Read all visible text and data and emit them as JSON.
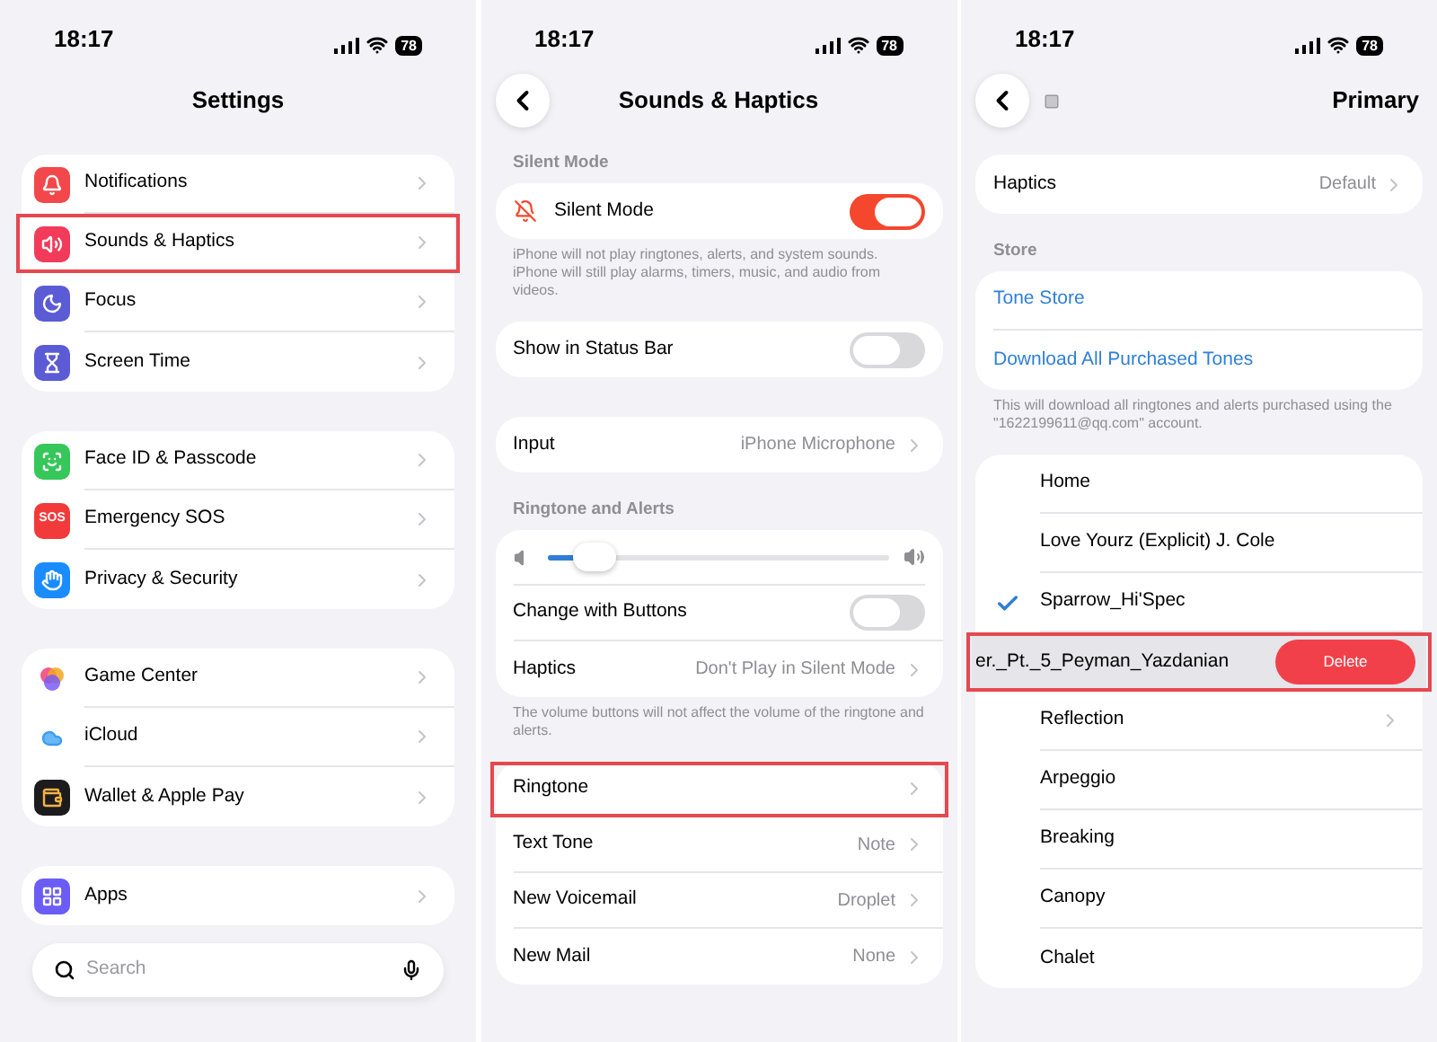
{
  "screens": [
    {
      "kind": "root",
      "status_bar": {
        "time": "18:17",
        "battery": "78"
      },
      "title": "Settings",
      "sections": [
        {
          "rows": [
            {
              "kind": "app",
              "label": "Notifications",
              "color": "#f2484b",
              "highlighted": false
            },
            {
              "kind": "app",
              "label": "Sounds & Haptics",
              "color": "#f23a5a",
              "highlighted": true
            },
            {
              "kind": "app",
              "label": "Focus",
              "color": "#5b5bd6",
              "highlighted": false
            },
            {
              "kind": "app",
              "label": "Screen Time",
              "color": "#5b5bd6",
              "highlighted": false
            }
          ]
        },
        {
          "rows": [
            {
              "kind": "app",
              "label": "Face ID & Passcode",
              "color": "#35c759",
              "highlighted": false
            },
            {
              "kind": "app",
              "label": "Emergency SOS",
              "color": "#f23a3a",
              "badge": "SOS",
              "highlighted": false
            },
            {
              "kind": "app",
              "label": "Privacy & Security",
              "color": "#1a8cff",
              "highlighted": false
            }
          ]
        },
        {
          "rows": [
            {
              "kind": "app",
              "label": "Game Center",
              "color": "#ffffff",
              "highlighted": false
            },
            {
              "kind": "app",
              "label": "iCloud",
              "color": "#ffffff",
              "highlighted": false
            },
            {
              "kind": "app",
              "label": "Wallet & Apple Pay",
              "color": "#1c1c1e",
              "highlighted": false
            }
          ]
        },
        {
          "rows": [
            {
              "kind": "app",
              "label": "Apps",
              "color": "#6a5cf5",
              "highlighted": false
            }
          ]
        }
      ],
      "search": {
        "placeholder": "Search"
      }
    },
    {
      "kind": "detail",
      "status_bar": {
        "time": "18:17",
        "battery": "78"
      },
      "title": "Sounds & Haptics",
      "sections": [
        {
          "header": "Silent Mode",
          "rows": [
            {
              "kind": "toggle",
              "label": "Silent Mode",
              "on": true
            }
          ],
          "footer": "iPhone will not play ringtones, alerts, and system sounds. iPhone will still play alarms, timers, music, and audio from videos."
        },
        {
          "rows": [
            {
              "kind": "toggle",
              "label": "Show in Status Bar",
              "on": false
            }
          ]
        },
        {
          "rows": [
            {
              "kind": "value",
              "label": "Input",
              "value": "iPhone Microphone"
            }
          ]
        },
        {
          "header": "Ringtone and Alerts",
          "rows": [
            {
              "kind": "slider",
              "level": 0.08
            },
            {
              "kind": "toggle",
              "label": "Change with Buttons",
              "on": false
            },
            {
              "kind": "value",
              "label": "Haptics",
              "value": "Don't Play in Silent Mode"
            }
          ],
          "footer": "The volume buttons will not affect the volume of the ringtone and alerts."
        },
        {
          "rows": [
            {
              "kind": "value",
              "label": "Ringtone",
              "highlighted": true
            },
            {
              "kind": "value",
              "label": "Text Tone",
              "value": "Note"
            },
            {
              "kind": "value",
              "label": "New Voicemail",
              "value": "Droplet"
            },
            {
              "kind": "value",
              "label": "New Mail",
              "value": "None"
            }
          ]
        }
      ]
    },
    {
      "kind": "picker",
      "status_bar": {
        "time": "18:17",
        "battery": "78"
      },
      "title": "Primary",
      "sections": [
        {
          "rows": [
            {
              "kind": "value",
              "label": "Haptics",
              "value": "Default"
            }
          ]
        },
        {
          "header": "Store",
          "rows": [
            {
              "kind": "link",
              "label": "Tone Store"
            },
            {
              "kind": "link",
              "label": "Download All Purchased Tones"
            }
          ],
          "footer": "This will download all ringtones and alerts purchased using the \"1622199611@qq.com\" account."
        },
        {
          "rows": [
            {
              "kind": "tone",
              "label": "Home",
              "selected": false
            },
            {
              "kind": "tone",
              "label": "Love Yourz (Explicit) J. Cole",
              "selected": false
            },
            {
              "kind": "tone",
              "label": "Sparrow_Hi'Spec",
              "selected": true
            },
            {
              "kind": "swiped",
              "label": "er._Pt._5_Peyman_Yazdanian",
              "action": "Delete",
              "highlighted": true
            },
            {
              "kind": "tone",
              "label": "Reflection",
              "selected": false,
              "chevron": true
            },
            {
              "kind": "tone",
              "label": "Arpeggio",
              "selected": false
            },
            {
              "kind": "tone",
              "label": "Breaking",
              "selected": false
            },
            {
              "kind": "tone",
              "label": "Canopy",
              "selected": false
            },
            {
              "kind": "tone",
              "label": "Chalet",
              "selected": false
            }
          ]
        }
      ]
    }
  ]
}
